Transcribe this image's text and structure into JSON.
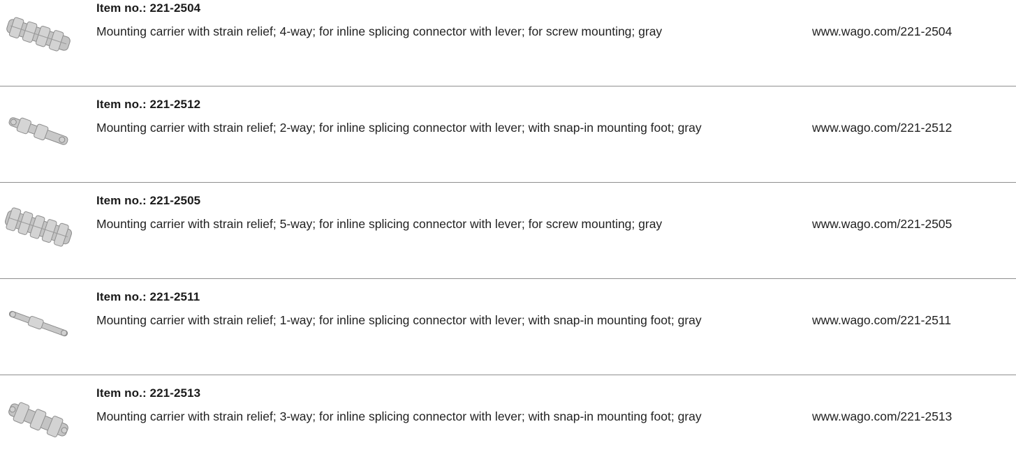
{
  "products": [
    {
      "item_no": "Item no.: 221-2504",
      "description": "Mounting carrier with strain relief; 4-way; for inline splicing connector with lever; for screw mounting; gray",
      "url": "www.wago.com/221-2504",
      "image_icon": "mounting-carrier-4way"
    },
    {
      "item_no": "Item no.: 221-2512",
      "description": "Mounting carrier with strain relief; 2-way; for inline splicing connector with lever; with snap-in mounting foot; gray",
      "url": "www.wago.com/221-2512",
      "image_icon": "mounting-carrier-2way"
    },
    {
      "item_no": "Item no.: 221-2505",
      "description": "Mounting carrier with strain relief; 5-way; for inline splicing connector with lever; for screw mounting; gray",
      "url": "www.wago.com/221-2505",
      "image_icon": "mounting-carrier-5way"
    },
    {
      "item_no": "Item no.: 221-2511",
      "description": "Mounting carrier with strain relief; 1-way; for inline splicing connector with lever; with snap-in mounting foot; gray",
      "url": "www.wago.com/221-2511",
      "image_icon": "mounting-carrier-1way"
    },
    {
      "item_no": "Item no.: 221-2513",
      "description": "Mounting carrier with strain relief; 3-way; for inline splicing connector with lever; with snap-in mounting foot; gray",
      "url": "www.wago.com/221-2513",
      "image_icon": "mounting-carrier-3way"
    }
  ],
  "colors": {
    "divider": "#8f8f8f",
    "text": "#1a1a1a",
    "product_gray": "#b9b9b9"
  }
}
